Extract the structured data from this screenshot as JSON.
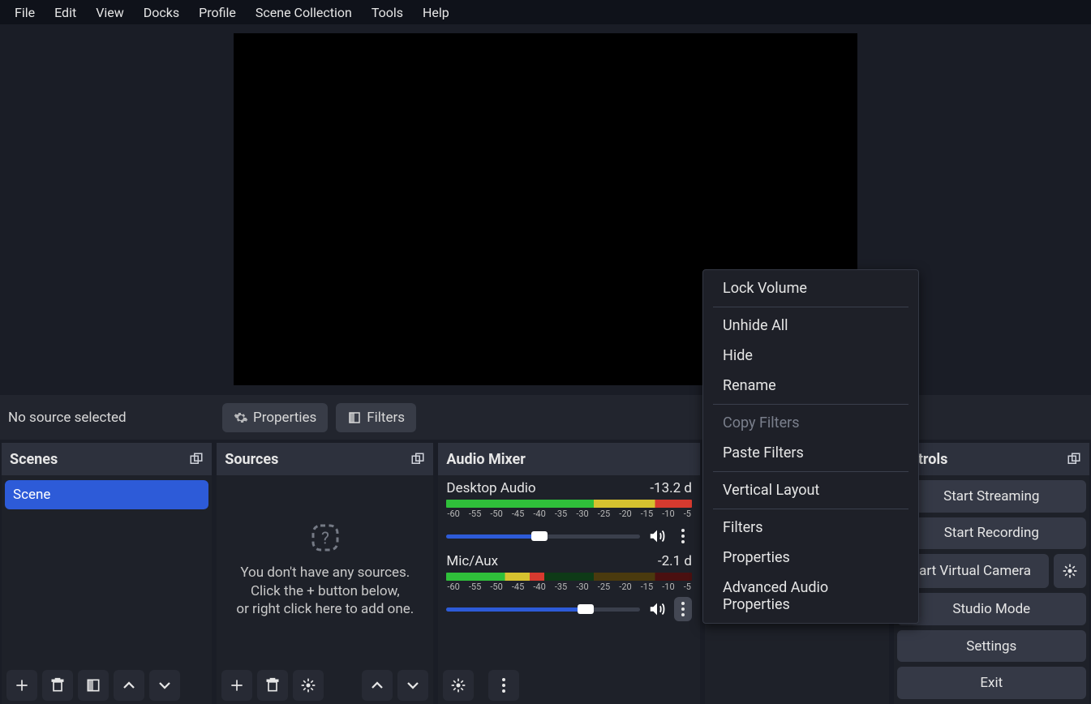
{
  "menubar": [
    "File",
    "Edit",
    "View",
    "Docks",
    "Profile",
    "Scene Collection",
    "Tools",
    "Help"
  ],
  "src_toolbar": {
    "no_source": "No source selected",
    "properties": "Properties",
    "filters": "Filters"
  },
  "scenes": {
    "title": "Scenes",
    "items": [
      "Scene"
    ]
  },
  "sources": {
    "title": "Sources",
    "empty1": "You don't have any sources.",
    "empty2": "Click the + button below,",
    "empty3": "or right click here to add one."
  },
  "mixer": {
    "title": "Audio Mixer",
    "ticks": [
      "-60",
      "-55",
      "-50",
      "-45",
      "-40",
      "-35",
      "-30",
      "-25",
      "-20",
      "-15",
      "-10",
      "-5"
    ],
    "channels": [
      {
        "name": "Desktop Audio",
        "db": "-13.2 d",
        "meter_pct": 100,
        "slider_pct": 48
      },
      {
        "name": "Mic/Aux",
        "db": "-2.1 d",
        "meter_pct": 40,
        "slider_pct": 72
      }
    ]
  },
  "transitions": {
    "title": ""
  },
  "controls": {
    "title": "ontrols",
    "buttons": {
      "stream": "Start Streaming",
      "record": "Start Recording",
      "vcam": "tart Virtual Camera",
      "studio": "Studio Mode",
      "settings": "Settings",
      "exit": "Exit"
    }
  },
  "context_menu": [
    {
      "label": "Lock Volume"
    },
    {
      "sep": true
    },
    {
      "label": "Unhide All"
    },
    {
      "label": "Hide"
    },
    {
      "label": "Rename"
    },
    {
      "sep": true
    },
    {
      "label": "Copy Filters",
      "disabled": true
    },
    {
      "label": "Paste Filters"
    },
    {
      "sep": true
    },
    {
      "label": "Vertical Layout"
    },
    {
      "sep": true
    },
    {
      "label": "Filters"
    },
    {
      "label": "Properties"
    },
    {
      "label": "Advanced Audio Properties"
    }
  ]
}
